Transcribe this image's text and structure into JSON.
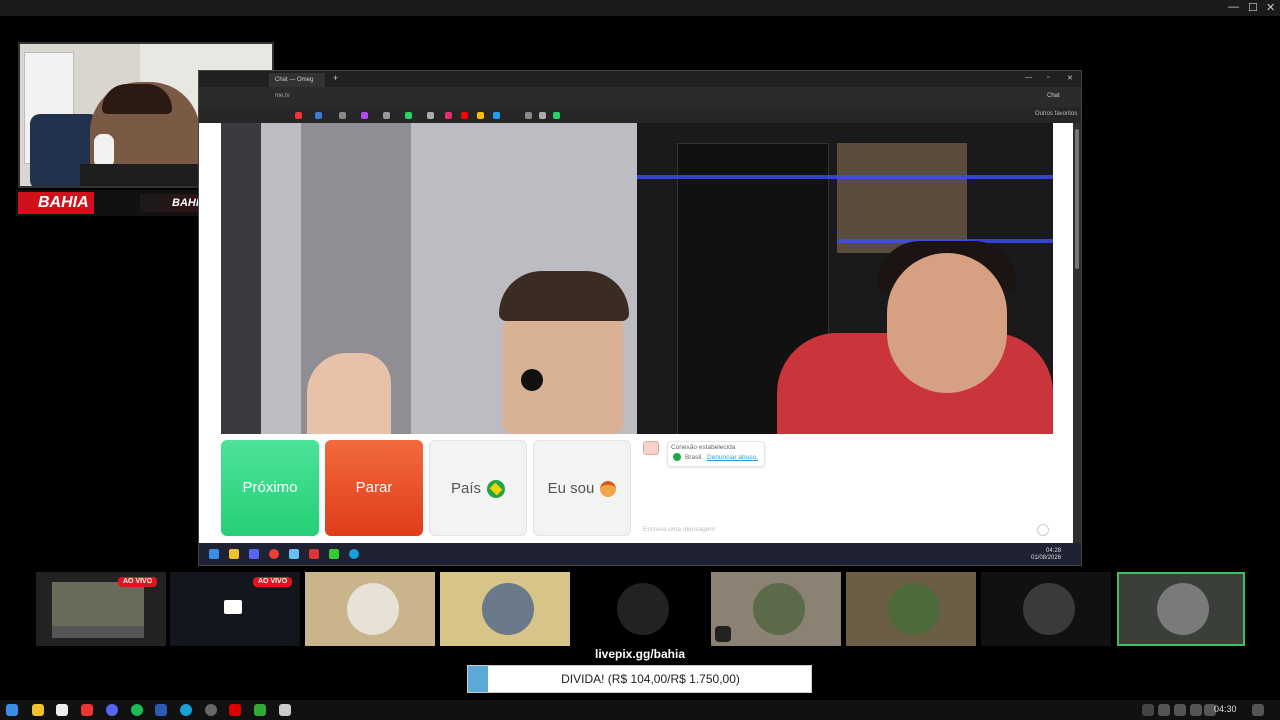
{
  "outer_window": {
    "controls": [
      "—",
      "☐",
      "✕"
    ]
  },
  "streamer": {
    "brand_left": "BAHIA",
    "brand_right": "BAHIAFPSS"
  },
  "browser": {
    "tab_title": "Chat — Omeg",
    "new_tab": "+",
    "url": "me.tv",
    "favorites_label": "Outros favoritos",
    "profile_label": "Chat",
    "window_controls": [
      "—",
      "▫",
      "✕"
    ]
  },
  "page": {
    "buttons": {
      "next": "Próximo",
      "stop": "Parar",
      "country": "País",
      "iam": "Eu sou"
    },
    "chat": {
      "status": "Conexão estabelecida",
      "country": "Brasil.",
      "report": "Denunciar abuso.",
      "input_placeholder": "Escreva uma mensagem"
    }
  },
  "inner_taskbar": {
    "time": "04:28",
    "date": "01/08/2026"
  },
  "participants": {
    "live_badge": "AO VIVO"
  },
  "donation": {
    "url": "livepix.gg/bahia",
    "text": "DIVIDA! (R$ 104,00/R$ 1.750,00)",
    "progress": 0.059
  },
  "taskbar": {
    "time": "04:30"
  },
  "colors": {
    "next": "#25cf76",
    "stop": "#df3c1a",
    "live": "#e0141e",
    "progress": "#5aa9d6",
    "selected_tile_border": "#3fbf5f"
  }
}
